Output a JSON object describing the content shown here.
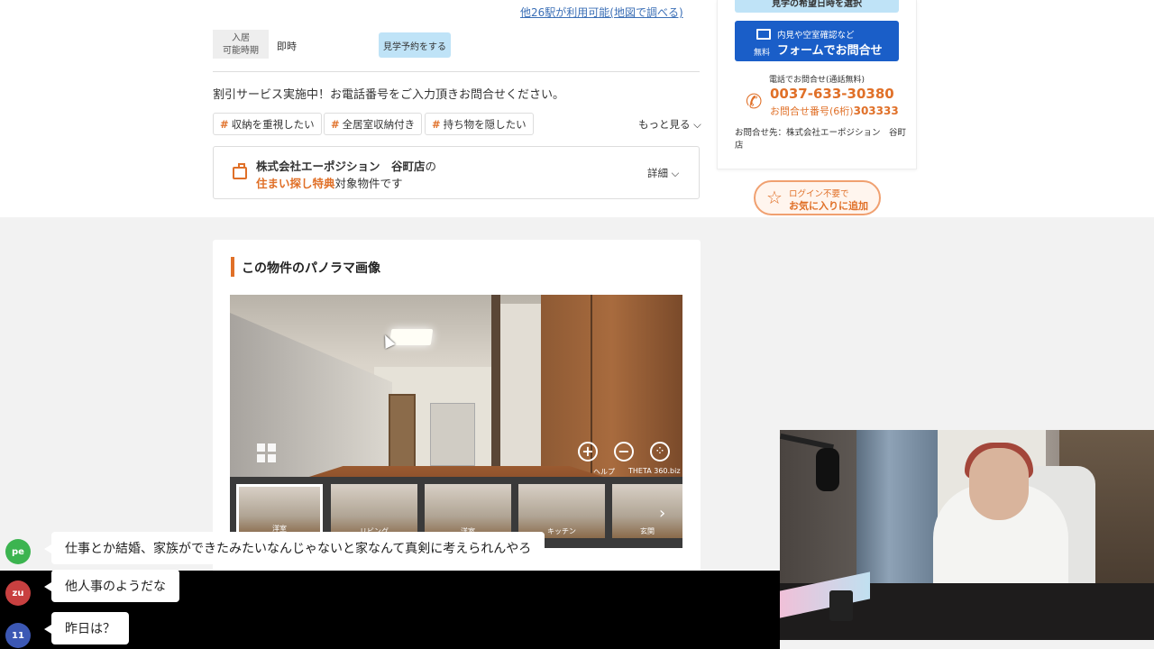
{
  "property": {
    "station_link": "他26駅が利用可能(地図で調べる)",
    "move_in_label": "入居\n可能時期",
    "move_in_value": "即時",
    "visit_button": "見学予約をする",
    "discount_text": "割引サービス実施中！お電話番号をご入力頂きお問合せください。",
    "tags": [
      "収納を重視したい",
      "全居室収納付き",
      "持ち物を隠したい"
    ],
    "more_label": "もっと見る",
    "bonus": {
      "company": "株式会社エーポジション　谷町店",
      "suffix1": "の",
      "highlight": "住まい探し特典",
      "suffix2": "対象物件です",
      "detail_label": "詳細"
    }
  },
  "sidebar": {
    "top_button_cut": "見学の希望日時を選択",
    "free_badge": "無料",
    "form_sub": "内見や空室確認など",
    "form_main": "フォームでお問合せ",
    "tel_label": "電話でお問合せ(通話無料)",
    "tel_number": "0037-633-30380",
    "tel_code_label": "お問合せ番号(6桁)",
    "tel_code": "303333",
    "contact": "お問合せ先：株式会社エーポジション　谷町店",
    "fav_line1": "ログイン不要で",
    "fav_line2": "お気に入りに追加"
  },
  "panorama": {
    "title": "この物件のパノラマ画像",
    "help_label": "ヘルプ",
    "theta_label": "THETA 360.biz",
    "thumbnails": [
      "洋室",
      "リビング",
      "洋室",
      "キッチン",
      "玄関"
    ]
  },
  "chat": [
    {
      "avatar": "pe",
      "color": "#3cb450",
      "text": "仕事とか結婚、家族ができたみたいなんじゃないと家なんて真剣に考えられんやろ"
    },
    {
      "avatar": "zu",
      "color": "#c84040",
      "text": "他人事のようだな"
    },
    {
      "avatar": "11",
      "color": "#3c58b4",
      "text": "昨日は？"
    }
  ]
}
